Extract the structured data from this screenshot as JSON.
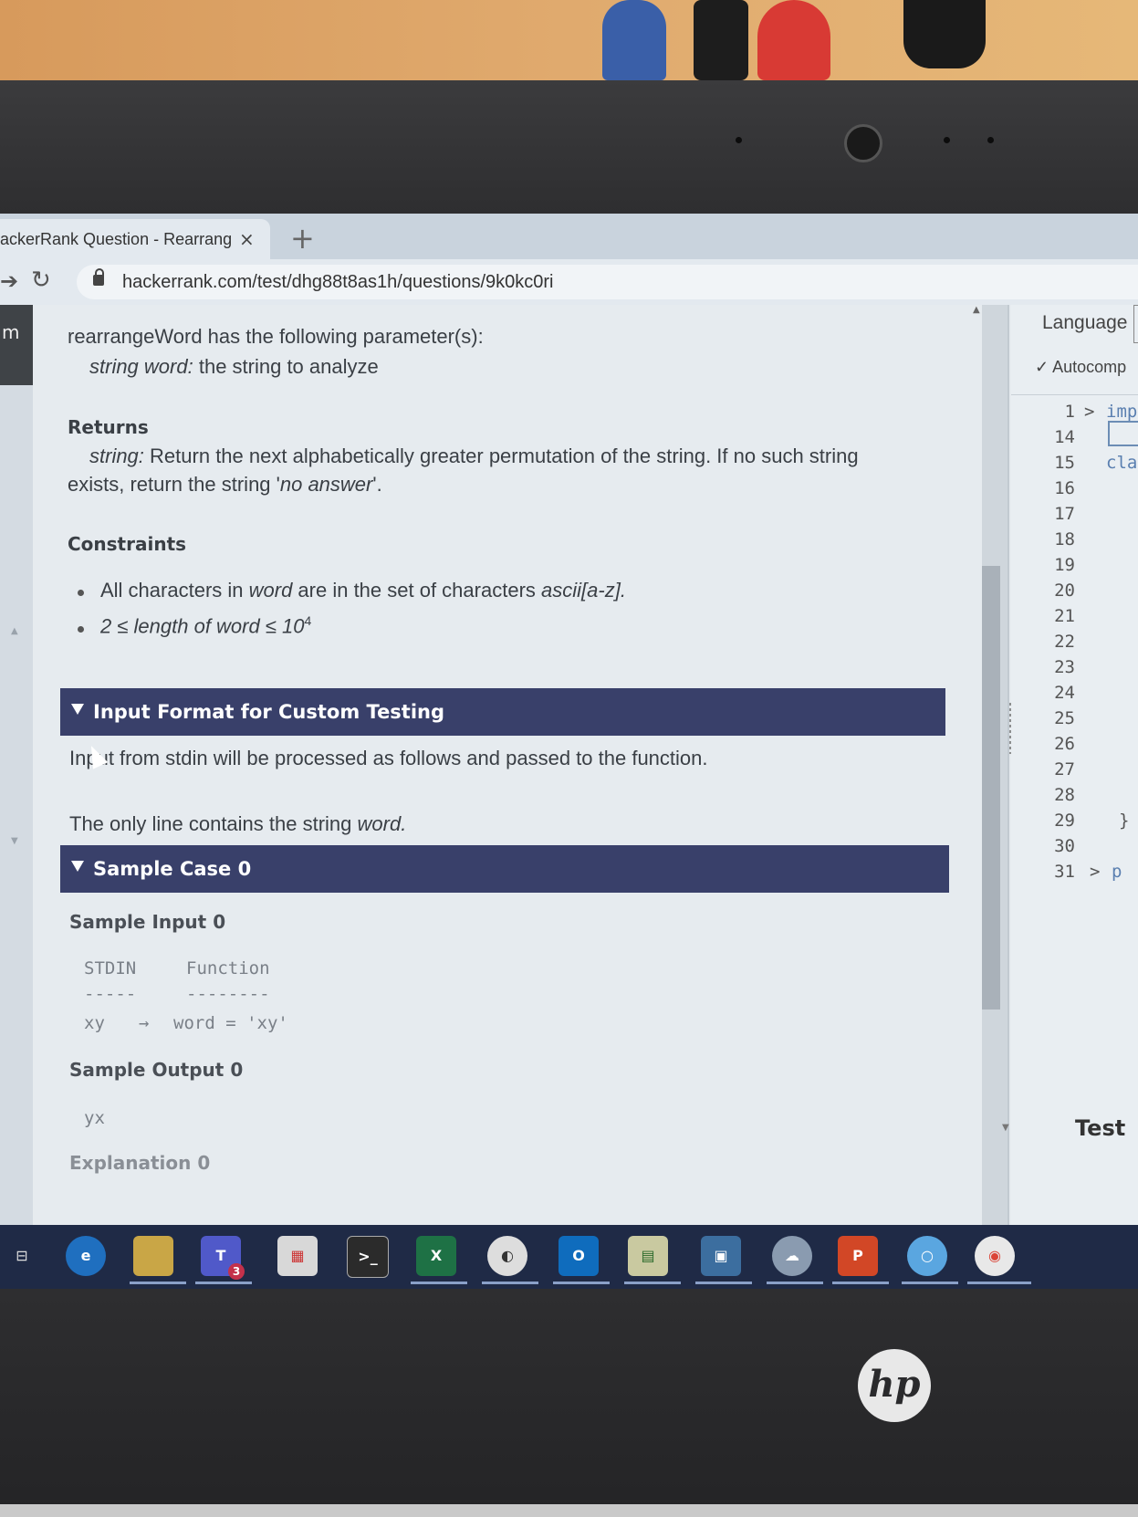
{
  "browser": {
    "tab_title": "ackerRank Question - Rearrang",
    "tab_close": "×",
    "new_tab": "+",
    "url": "hackerrank.com/test/dhg88t8as1h/questions/9k0kc0ri"
  },
  "problem": {
    "params_intro": "rearrangeWord has the following parameter(s):",
    "param_type": "string word:",
    "param_desc": "the string to analyze",
    "returns_heading": "Returns",
    "returns_type": "string:",
    "returns_desc_1": "Return the next alphabetically greater permutation of the string. If no such string",
    "returns_desc_2_pre": "exists, return the string '",
    "returns_desc_2_em": "no answer",
    "returns_desc_2_post": "'.",
    "constraints_heading": "Constraints",
    "constraint_1_a": "All characters in ",
    "constraint_1_em": "word",
    "constraint_1_b": " are in the set of characters ",
    "constraint_1_em2": "ascii[a-z].",
    "constraint_2": "2 ≤ length of word ≤ 10",
    "constraint_2_sup": "4",
    "input_format_title": "Input Format for Custom Testing",
    "input_format_line_1": "Input from stdin will be processed as follows and passed to the function.",
    "input_format_line_2_pre": "The only line contains the string ",
    "input_format_line_2_em": "word.",
    "sample_case_title": "Sample Case 0",
    "sample_input_heading": "Sample Input 0",
    "stdin_header": "STDIN",
    "function_header": "Function",
    "stdin_rule": "-----",
    "function_rule": "--------",
    "stdin_value": "xy",
    "arrow": "→",
    "function_value": "word = 'xy'",
    "sample_output_heading": "Sample Output 0",
    "sample_output_value": "yx",
    "explanation_heading": "Explanation 0"
  },
  "left_rail": {
    "label": "m"
  },
  "editor": {
    "language_label": "Language",
    "autocomplete_label": "Autocomp",
    "line_numbers": [
      "1",
      "14",
      "15",
      "16",
      "17",
      "18",
      "19",
      "20",
      "21",
      "22",
      "23",
      "24",
      "25",
      "26",
      "27",
      "28",
      "29",
      "30",
      "31"
    ],
    "line_1_code": "imp",
    "line_15_code": "cla",
    "line_29_code": "}",
    "line_31_code": "p",
    "test_button": "Test"
  },
  "taskbar": {
    "items": [
      "task-view",
      "edge",
      "file-explorer",
      "teams",
      "store",
      "terminal",
      "excel",
      "browser-globe",
      "outlook",
      "project",
      "app-lock",
      "app-cloud",
      "powerpoint",
      "cortana",
      "chrome"
    ],
    "teams_badge": "3"
  },
  "brand": {
    "logo": "hp"
  },
  "colors": {
    "section_bar": "#39406a",
    "taskbar": "#1f2a46",
    "accent_blue": "#5a7fb0"
  }
}
